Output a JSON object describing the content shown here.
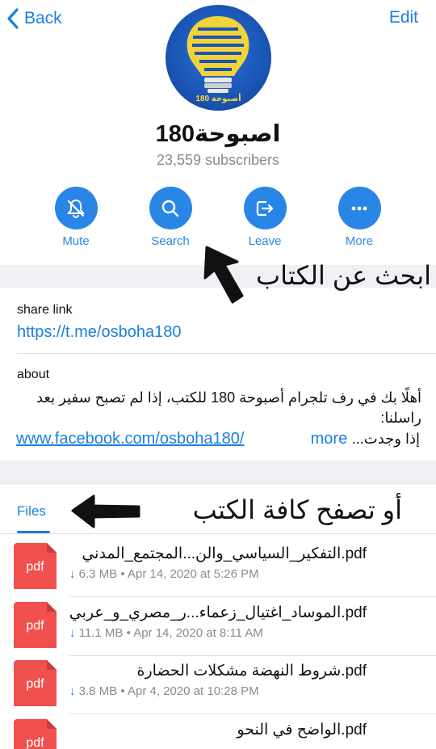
{
  "nav": {
    "back_label": "Back",
    "edit_label": "Edit"
  },
  "channel": {
    "name": "اصبوحة180",
    "subscribers": "23,559 subscribers",
    "avatar_caption": "أصبوحة 180"
  },
  "actions": [
    {
      "label": "Mute",
      "icon": "bell-slash-icon"
    },
    {
      "label": "Search",
      "icon": "search-icon"
    },
    {
      "label": "Leave",
      "icon": "leave-icon"
    },
    {
      "label": "More",
      "icon": "more-icon"
    }
  ],
  "info": {
    "share_label": "share link",
    "share_url": "https://t.me/osboha180",
    "about_label": "about",
    "about_text": "أهلًا بك في رف تلجرام أصبوحة 180 للكتب، إذا لم تصبح سفير بعد راسلنا:",
    "about_link": "www.facebook.com/osboha180/",
    "about_tail": "إذا وجدت...",
    "more_label": "more"
  },
  "annotations": {
    "search_hint": "ابحث عن الكتاب",
    "browse_hint": "أو تصفح كافة الكتب"
  },
  "tabs": {
    "files": "Files"
  },
  "files": [
    {
      "name": "التفكير_السياسي_والن...المجتمع_المدني.pdf",
      "size": "6.3 MB",
      "date": "Apr 14, 2020 at 5:26 PM",
      "icon_label": "pdf"
    },
    {
      "name": "الموساد_اغتيال_زعماء...ر_مصري_و_عربي.pdf",
      "size": "11.1 MB",
      "date": "Apr 14, 2020 at 8:11 AM",
      "icon_label": "pdf"
    },
    {
      "name": "شروط النهضة مشكلات الحضارة.pdf",
      "size": "3.8 MB",
      "date": "Apr 4, 2020 at 10:28 PM",
      "icon_label": "pdf"
    },
    {
      "name": "الواضح في النحو.pdf",
      "size": "",
      "date": "",
      "icon_label": "pdf"
    }
  ],
  "colors": {
    "accent": "#2a86e6",
    "link": "#1a7fe0",
    "pdf_icon": "#f0504e",
    "separator": "#efeff4"
  }
}
